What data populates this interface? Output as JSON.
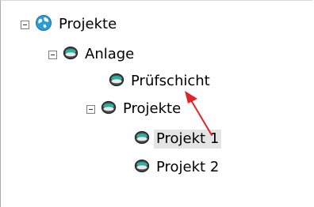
{
  "tree": {
    "root": {
      "label": "Projekte",
      "icon": "globe-icon",
      "expanded": true
    },
    "anlage": {
      "label": "Anlage",
      "icon": "layer-disc-icon",
      "expanded": true
    },
    "pruefschicht": {
      "label": "Prüfschicht",
      "icon": "layer-disc-icon"
    },
    "projekte": {
      "label": "Projekte",
      "icon": "layer-disc-icon",
      "expanded": true
    },
    "projekt1": {
      "label": "Projekt 1",
      "icon": "layer-disc-icon",
      "selected": true
    },
    "projekt2": {
      "label": "Projekt 2",
      "icon": "layer-disc-icon"
    }
  },
  "colors": {
    "cursor": "#e2242a",
    "selection": "#e4e4e4",
    "globe": "#2a9fd6"
  }
}
